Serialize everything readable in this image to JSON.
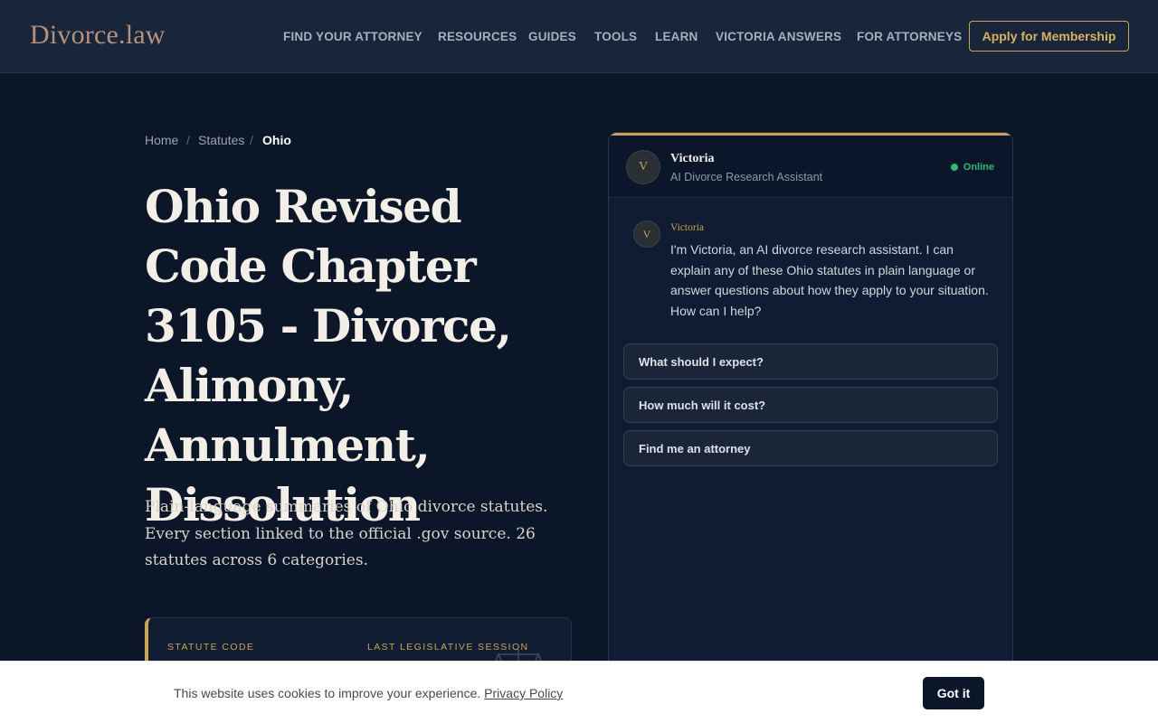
{
  "header": {
    "logo": "Divorce.law",
    "nav": [
      "FIND YOUR ATTORNEY",
      "RESOURCES",
      "GUIDES",
      "TOOLS",
      "LEARN",
      "VICTORIA ANSWERS",
      "FOR ATTORNEYS"
    ],
    "cta_label": "Apply for Membership"
  },
  "breadcrumb": {
    "home": "Home",
    "statutes": "Statutes",
    "current": "Ohio",
    "separator": "/"
  },
  "page": {
    "title": "Ohio Revised Code Chapter 3105 - Divorce, Alimony, Annulment, Dissolution",
    "subtitle": "Plain-language summaries of Ohio divorce statutes. Every section linked to the official .gov source. 26 statutes across 6 categories."
  },
  "info_card": {
    "label_code": "STATUTE CODE",
    "label_session": "LAST LEGISLATIVE SESSION",
    "icon": "scales-of-justice-icon"
  },
  "chat": {
    "avatar_initial": "V",
    "agent_name": "Victoria",
    "agent_role": "AI Divorce Research Assistant",
    "status": "Online",
    "message": {
      "sender": "Victoria",
      "text": "I'm Victoria, an AI divorce research assistant. I can explain any of these Ohio statutes in plain language or answer questions about how they apply to your situation. How can I help?"
    },
    "suggestions": [
      "What should I expect?",
      "How much will it cost?",
      "Find me an attorney"
    ]
  },
  "cookie": {
    "text": "This website uses cookies to improve your experience.",
    "link": "Privacy Policy",
    "button": "Got it"
  },
  "colors": {
    "background": "#0c1629",
    "header": "#18253a",
    "accent_gold": "#c9a64b",
    "logo": "#b7927a",
    "online_green": "#2fb873"
  }
}
